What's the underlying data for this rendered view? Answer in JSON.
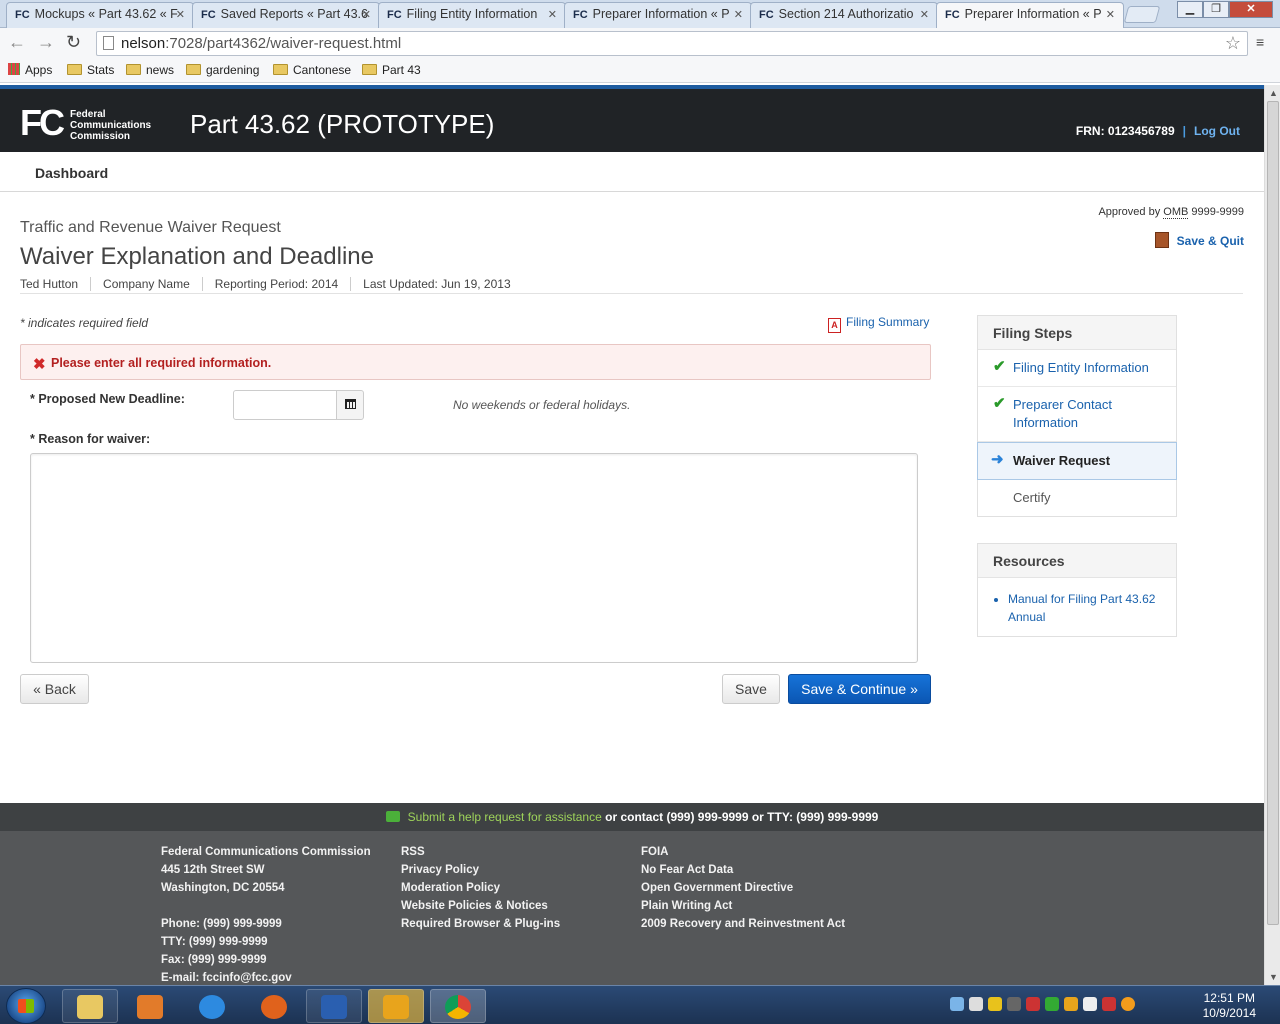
{
  "browser": {
    "tabs": [
      {
        "title": "Mockups « Part 43.62 « F"
      },
      {
        "title": "Saved Reports « Part 43.6"
      },
      {
        "title": "Filing Entity Information"
      },
      {
        "title": "Preparer Information « P"
      },
      {
        "title": "Section 214 Authorizatio"
      },
      {
        "title": "Preparer Information « P"
      }
    ],
    "tab_logo": "FC",
    "url_host": "nelson",
    "url_rest": ":7028/part4362/waiver-request.html",
    "bookmarks": [
      "Apps",
      "Stats",
      "news",
      "gardening",
      "Cantonese",
      "Part 43"
    ]
  },
  "header": {
    "logo_mark": "FC",
    "logo_line1": "Federal",
    "logo_line2": "Communications",
    "logo_line3": "Commission",
    "app_title": "Part 43.62 (PROTOTYPE)",
    "frn": "FRN: 0123456789",
    "separator": "|",
    "logout": "Log Out"
  },
  "nav": {
    "dashboard": "Dashboard"
  },
  "page": {
    "supertitle": "Traffic and Revenue Waiver Request",
    "title": "Waiver Explanation and Deadline",
    "meta": [
      "Ted Hutton",
      "Company Name",
      "Reporting Period: 2014",
      "Last Updated: Jun 19, 2013"
    ],
    "omb_prefix": "Approved by",
    "omb": "OMB",
    "omb_number": "9999-9999",
    "save_quit": "Save & Quit"
  },
  "form": {
    "required_note": "* indicates required field",
    "filing_summary": "Filing Summary",
    "error": "Please enter all required information.",
    "deadline_label": "* Proposed New Deadline:",
    "deadline_value": "",
    "deadline_hint": "No weekends or federal holidays.",
    "reason_label": "* Reason for waiver:",
    "reason_value": "",
    "back": "« Back",
    "save": "Save",
    "save_continue": "Save & Continue »"
  },
  "sidebar": {
    "steps_title": "Filing Steps",
    "steps": [
      {
        "label": "Filing Entity Information",
        "state": "done"
      },
      {
        "label": "Preparer Contact Information",
        "state": "done"
      },
      {
        "label": "Waiver Request",
        "state": "current"
      },
      {
        "label": "Certify",
        "state": "todo"
      }
    ],
    "resources_title": "Resources",
    "resources": [
      "Manual for Filing Part 43.62 Annual"
    ]
  },
  "footer": {
    "help_link": "Submit a help request for assistance",
    "help_rest": "or contact (999) 999-9999 or TTY: (999) 999-9999",
    "col1": [
      "Federal Communications Commission",
      "445 12th Street SW",
      "Washington, DC 20554"
    ],
    "col1b": [
      "Phone: (999) 999-9999",
      "TTY: (999) 999-9999",
      "Fax: (999) 999-9999",
      "E-mail: fccinfo@fcc.gov"
    ],
    "col2": [
      "RSS",
      "Privacy Policy",
      "Moderation Policy",
      "Website Policies & Notices",
      "Required Browser & Plug-ins"
    ],
    "col3": [
      "FOIA",
      "No Fear Act Data",
      "Open Government Directive",
      "Plain Writing Act",
      "2009 Recovery and Reinvestment Act"
    ]
  },
  "taskbar": {
    "time": "12:51 PM",
    "date": "10/9/2014"
  },
  "colors": {
    "accent": "#1a62ad",
    "primary_button": "#0b56b3",
    "error": "#b32020",
    "header_bg": "#202326"
  }
}
